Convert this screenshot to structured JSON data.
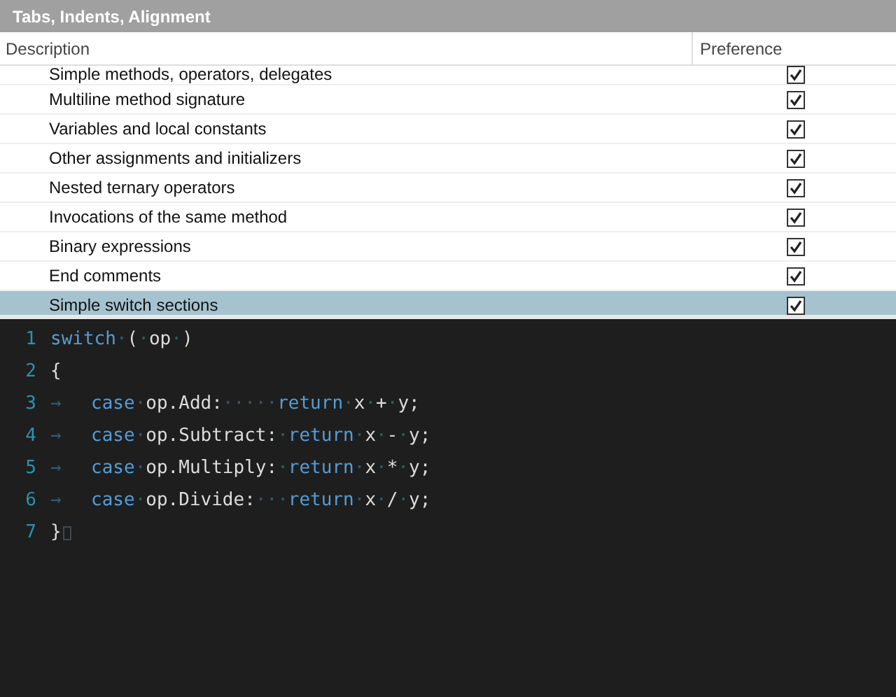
{
  "section_title": "Tabs, Indents, Alignment",
  "columns": [
    "Description",
    "Preference"
  ],
  "rows": [
    {
      "label": "Simple methods, operators, delegates",
      "checked": true,
      "selected": false
    },
    {
      "label": "Multiline method signature",
      "checked": true,
      "selected": false
    },
    {
      "label": "Variables and local constants",
      "checked": true,
      "selected": false
    },
    {
      "label": "Other assignments and initializers",
      "checked": true,
      "selected": false
    },
    {
      "label": "Nested ternary operators",
      "checked": true,
      "selected": false
    },
    {
      "label": "Invocations of the same method",
      "checked": true,
      "selected": false
    },
    {
      "label": "Binary expressions",
      "checked": true,
      "selected": false
    },
    {
      "label": "End comments",
      "checked": true,
      "selected": false
    },
    {
      "label": "Simple switch sections",
      "checked": true,
      "selected": true
    }
  ],
  "code_lines": [
    {
      "number": "1",
      "tokens": [
        {
          "kind": "keyword",
          "text": "switch"
        },
        {
          "kind": "ws",
          "text": "·"
        },
        {
          "kind": "plain",
          "text": "("
        },
        {
          "kind": "ws",
          "text": "·"
        },
        {
          "kind": "plain",
          "text": "op"
        },
        {
          "kind": "ws",
          "text": "·"
        },
        {
          "kind": "plain",
          "text": ")"
        }
      ]
    },
    {
      "number": "2",
      "tokens": [
        {
          "kind": "plain",
          "text": "{"
        }
      ]
    },
    {
      "number": "3",
      "tokens": [
        {
          "kind": "tab",
          "text": "→"
        },
        {
          "kind": "keyword",
          "text": "case"
        },
        {
          "kind": "ws",
          "text": "·"
        },
        {
          "kind": "plain",
          "text": "op.Add:"
        },
        {
          "kind": "ws",
          "text": "·····"
        },
        {
          "kind": "keyword",
          "text": "return"
        },
        {
          "kind": "ws",
          "text": "·"
        },
        {
          "kind": "plain",
          "text": "x"
        },
        {
          "kind": "ws",
          "text": "·"
        },
        {
          "kind": "plain",
          "text": "+"
        },
        {
          "kind": "ws",
          "text": "·"
        },
        {
          "kind": "plain",
          "text": "y;"
        }
      ]
    },
    {
      "number": "4",
      "tokens": [
        {
          "kind": "tab",
          "text": "→"
        },
        {
          "kind": "keyword",
          "text": "case"
        },
        {
          "kind": "ws",
          "text": "·"
        },
        {
          "kind": "plain",
          "text": "op.Subtract:"
        },
        {
          "kind": "ws",
          "text": "·"
        },
        {
          "kind": "keyword",
          "text": "return"
        },
        {
          "kind": "ws",
          "text": "·"
        },
        {
          "kind": "plain",
          "text": "x"
        },
        {
          "kind": "ws",
          "text": "·"
        },
        {
          "kind": "plain",
          "text": "-"
        },
        {
          "kind": "ws",
          "text": "·"
        },
        {
          "kind": "plain",
          "text": "y;"
        }
      ]
    },
    {
      "number": "5",
      "tokens": [
        {
          "kind": "tab",
          "text": "→"
        },
        {
          "kind": "keyword",
          "text": "case"
        },
        {
          "kind": "ws",
          "text": "·"
        },
        {
          "kind": "plain",
          "text": "op.Multiply:"
        },
        {
          "kind": "ws",
          "text": "·"
        },
        {
          "kind": "keyword",
          "text": "return"
        },
        {
          "kind": "ws",
          "text": "·"
        },
        {
          "kind": "plain",
          "text": "x"
        },
        {
          "kind": "ws",
          "text": "·"
        },
        {
          "kind": "plain",
          "text": "*"
        },
        {
          "kind": "ws",
          "text": "·"
        },
        {
          "kind": "plain",
          "text": "y;"
        }
      ]
    },
    {
      "number": "6",
      "tokens": [
        {
          "kind": "tab",
          "text": "→"
        },
        {
          "kind": "keyword",
          "text": "case"
        },
        {
          "kind": "ws",
          "text": "·"
        },
        {
          "kind": "plain",
          "text": "op.Divide:"
        },
        {
          "kind": "ws",
          "text": "···"
        },
        {
          "kind": "keyword",
          "text": "return"
        },
        {
          "kind": "ws",
          "text": "·"
        },
        {
          "kind": "plain",
          "text": "x"
        },
        {
          "kind": "ws",
          "text": "·"
        },
        {
          "kind": "plain",
          "text": "/"
        },
        {
          "kind": "ws",
          "text": "·"
        },
        {
          "kind": "plain",
          "text": "y;"
        }
      ]
    },
    {
      "number": "7",
      "tokens": [
        {
          "kind": "plain",
          "text": "}"
        },
        {
          "kind": "eol"
        }
      ]
    }
  ]
}
